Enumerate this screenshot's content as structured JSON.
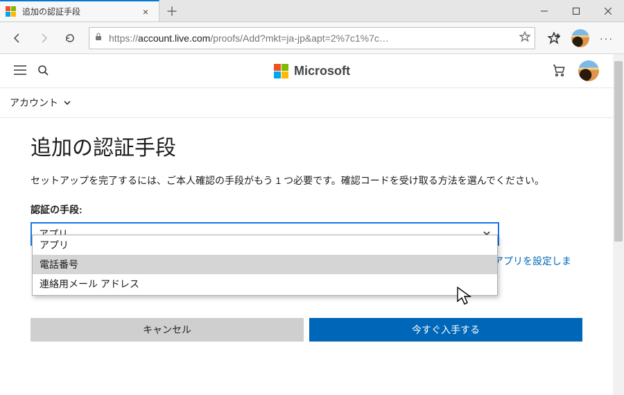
{
  "browser": {
    "tab_title": "追加の認証手段",
    "url_host": "account.live.com",
    "url_prefix": "https://",
    "url_path": "/proofs/Add?mkt=ja-jp&apt=2%7c1%7c…"
  },
  "msheader": {
    "brand": "Microsoft"
  },
  "subnav": {
    "label": "アカウント"
  },
  "page": {
    "title": "追加の認証手段",
    "description": "セットアップを完了するには、ご本人確認の手段がもう 1 つ必要です。確認コードを受け取る方法を選んでください。",
    "field_label": "認証の手段:",
    "selected": "アプリ",
    "options": [
      "アプリ",
      "電話番号",
      "連絡用メール アドレス"
    ],
    "hovered_index": 1,
    "link_fragment": "証アプリを設定しま",
    "cancel": "キャンセル",
    "primary": "今すぐ入手する"
  }
}
